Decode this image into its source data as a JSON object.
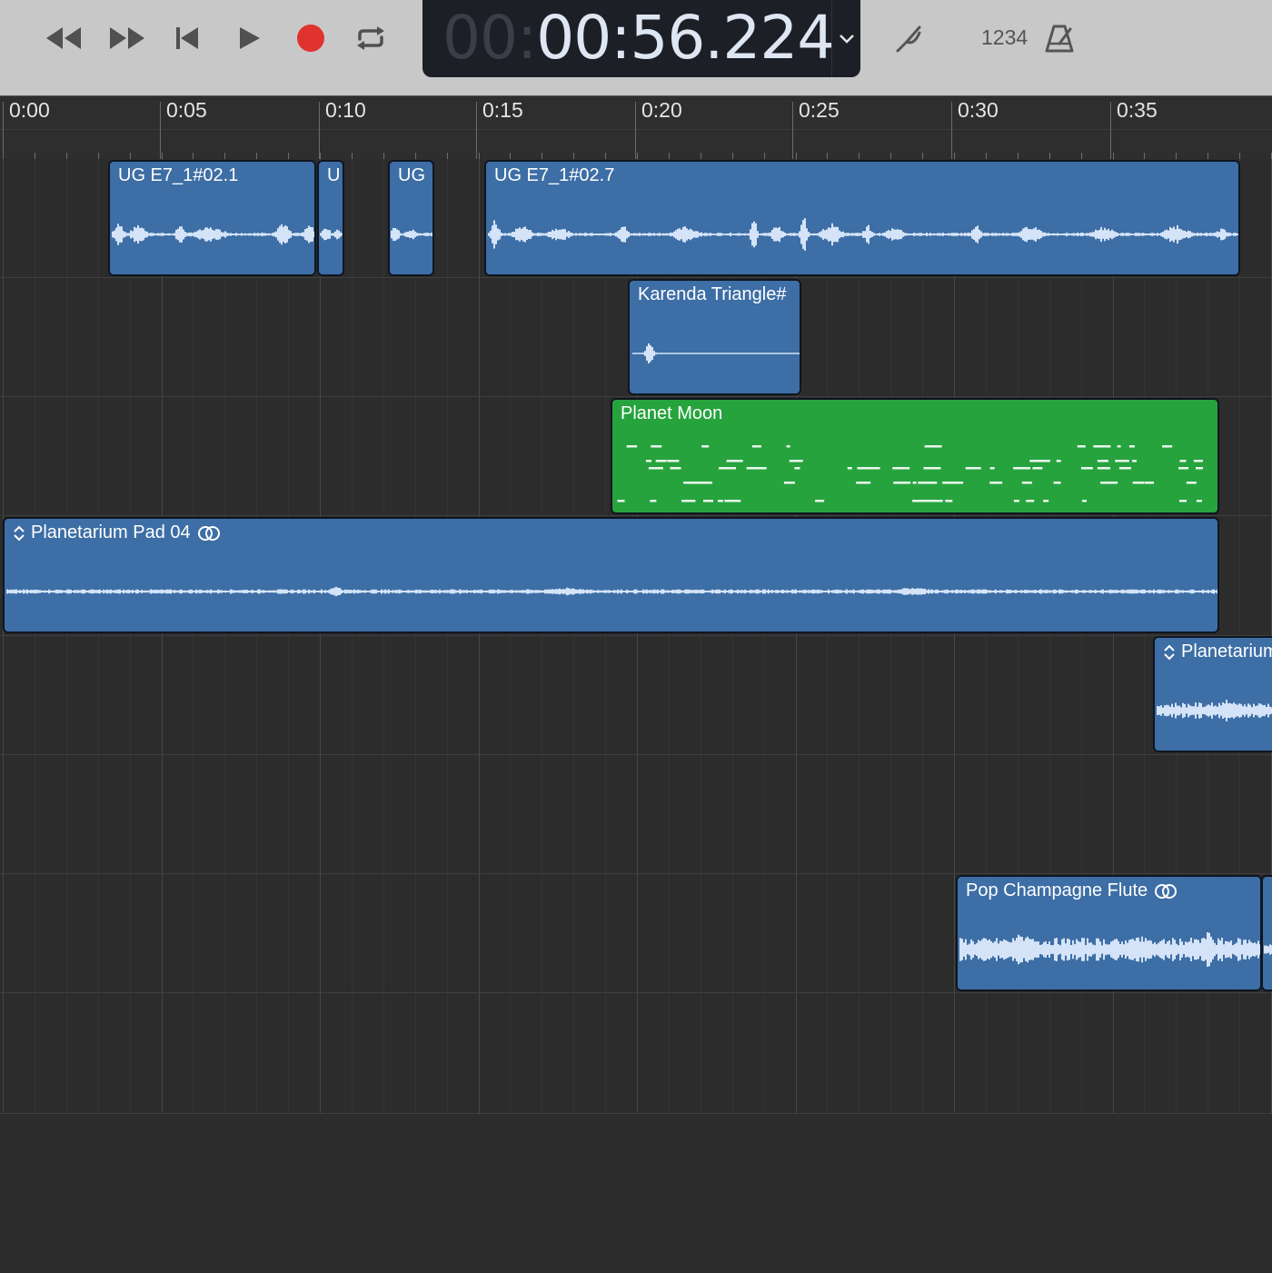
{
  "transport": {
    "buttons": [
      "rewind",
      "fast-forward",
      "go-to-beginning",
      "play",
      "record",
      "cycle"
    ],
    "record_color": "#e0322e"
  },
  "lcd": {
    "time_dim": "00:",
    "time_main": "00:56.224"
  },
  "counter_label": "1234",
  "ruler": {
    "labels": [
      "0:00",
      "0:05",
      "0:10",
      "0:15",
      "0:20",
      "0:25",
      "0:30",
      "0:35"
    ]
  },
  "regions": [
    {
      "name": "UG E7_1#02.1",
      "color": "#3d6ea5",
      "type": "audio",
      "track": 1
    },
    {
      "name": "U",
      "color": "#3d6ea5",
      "type": "audio",
      "track": 1
    },
    {
      "name": "UG",
      "color": "#3d6ea5",
      "type": "audio",
      "track": 1
    },
    {
      "name": "UG E7_1#02.7",
      "color": "#3d6ea5",
      "type": "audio",
      "track": 1
    },
    {
      "name": "Karenda Triangle#",
      "color": "#3d6ea5",
      "type": "audio",
      "track": 2
    },
    {
      "name": "Planet Moon",
      "color": "#27a33e",
      "type": "midi",
      "track": 3
    },
    {
      "name": "Planetarium Pad 04",
      "color": "#3d6ea5",
      "type": "audio",
      "track": 4
    },
    {
      "name": "Planetarium",
      "color": "#3d6ea5",
      "type": "audio",
      "track": 5
    },
    {
      "name": "Pop Champagne Flute",
      "color": "#3d6ea5",
      "type": "audio",
      "track": 7
    }
  ]
}
